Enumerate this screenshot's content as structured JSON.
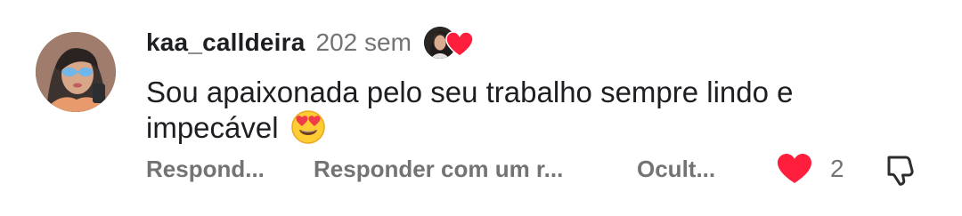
{
  "comment": {
    "username": "kaa_calldeira",
    "time": "202 sem",
    "text": "Sou apaixonada pelo seu trabalho sempre lindo e impecável",
    "emoji": "smiling-face-with-heart-eyes",
    "actions": {
      "reply": "Respond...",
      "reply_sticker": "Responder com um r...",
      "hide": "Ocult...",
      "like_count": "2"
    },
    "icons": {
      "avatar": "user-avatar",
      "author_like": "author-liked-heart-icon",
      "like": "heart-icon",
      "dislike": "thumbs-down-icon"
    },
    "colors": {
      "heart": "#ff1f3d",
      "secondary_text": "#737373",
      "primary_text": "#1c1e21"
    }
  }
}
